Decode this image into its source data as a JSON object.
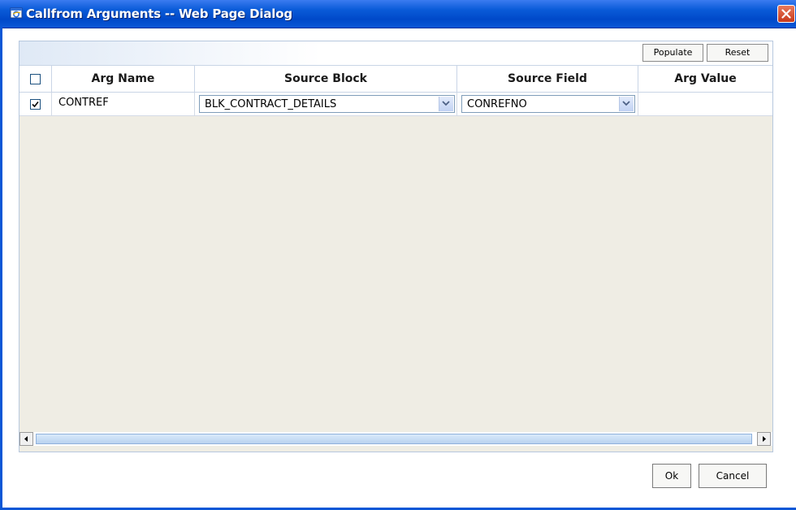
{
  "window": {
    "title": "Callfrom Arguments -- Web Page Dialog",
    "accent_color": "#0a57d6"
  },
  "toolbar": {
    "populate_label": "Populate",
    "reset_label": "Reset"
  },
  "grid": {
    "columns": [
      "Arg Name",
      "Source Block",
      "Source Field",
      "Arg Value"
    ],
    "select_all_checked": false,
    "rows": [
      {
        "checked": true,
        "arg_name": "CONTREF",
        "source_block": "BLK_CONTRACT_DETAILS",
        "source_field": "CONREFNO",
        "arg_value": ""
      }
    ]
  },
  "footer": {
    "ok_label": "Ok",
    "cancel_label": "Cancel"
  },
  "icons": {
    "title": "ie-dialog-icon",
    "close": "close-icon",
    "dropdown": "chevron-down-icon",
    "check": "checkmark-icon",
    "scroll_left": "arrow-left-icon",
    "scroll_right": "arrow-right-icon"
  }
}
